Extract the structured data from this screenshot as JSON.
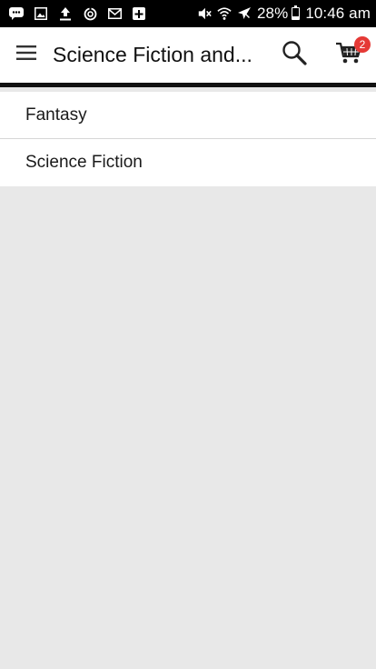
{
  "status_bar": {
    "icons": [
      "chat-icon",
      "image-icon",
      "upload-icon",
      "sync-icon",
      "mail-icon",
      "calendar-icon",
      "mute-icon",
      "wifi-icon",
      "airplane-icon"
    ],
    "battery": "28%",
    "time": "10:46 am"
  },
  "toolbar": {
    "title": "Science Fiction and...",
    "cart_count": "2"
  },
  "categories": [
    {
      "label": "Fantasy"
    },
    {
      "label": "Science Fiction"
    }
  ],
  "colors": {
    "badge": "#e53935",
    "background": "#e8e8e8",
    "toolbar_border": "#111111"
  }
}
